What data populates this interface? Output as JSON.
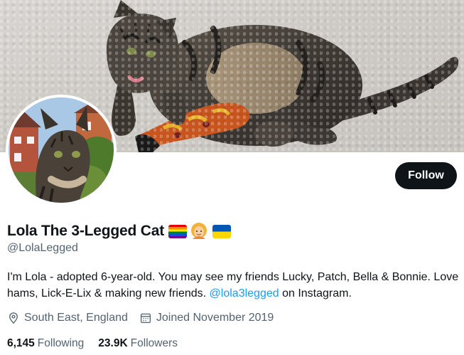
{
  "profile": {
    "display_name": "Lola The 3-Legged Cat",
    "handle": "@LolaLegged",
    "bio_text": "I'm Lola - adopted 6-year-old. You may see my friends Lucky, Patch, Bella & Bonnie. Love hams, Lick-E-Lix & making new friends. ",
    "bio_link": "@lola3legged",
    "bio_suffix": " on Instagram.",
    "location": "South East, England",
    "joined": "Joined November 2019",
    "following_count": "6,145",
    "following_label": "Following",
    "followers_count": "23.9K",
    "followers_label": "Followers"
  },
  "actions": {
    "follow_label": "Follow"
  },
  "icons": {
    "location": "location-pin-icon",
    "calendar": "calendar-icon",
    "name_emojis": [
      "rainbow-flag-icon",
      "person-blonde-icon",
      "ukraine-flag-icon"
    ]
  },
  "colors": {
    "link": "#1d9bf0",
    "button_bg": "#0f1419",
    "secondary_text": "#536471"
  }
}
